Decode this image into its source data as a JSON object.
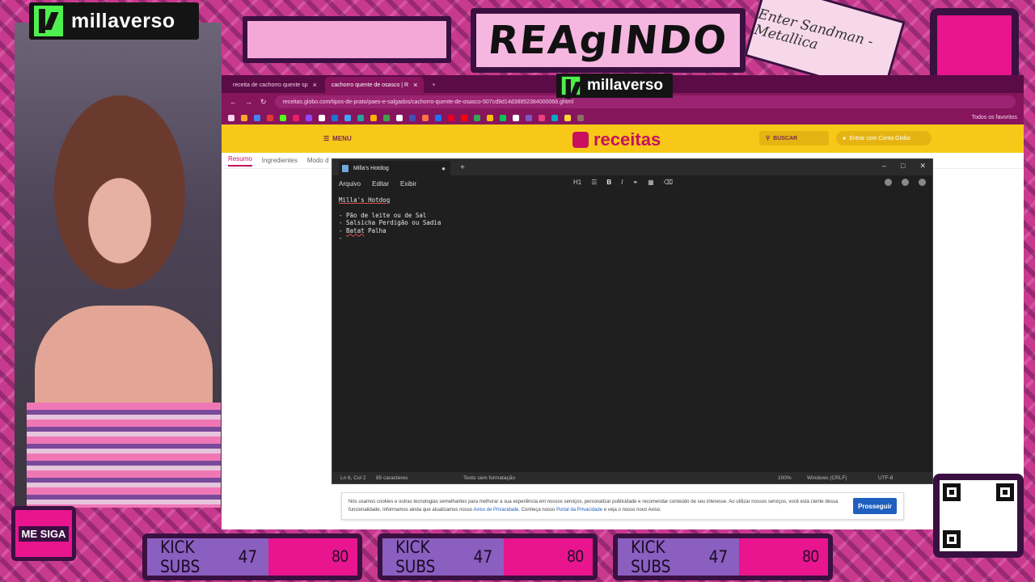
{
  "stream": {
    "channel": "millaverso",
    "banner": "REAgINDO",
    "tape_text": "Enter Sandman - Metallica",
    "follow_label": "ME SIGA",
    "subs_bars": [
      {
        "label": "KICK SUBS",
        "current": "47",
        "goal": "80"
      },
      {
        "label": "KICK SUBS",
        "current": "47",
        "goal": "80"
      },
      {
        "label": "KICK SUBS",
        "current": "47",
        "goal": "80"
      }
    ],
    "accent": "#e8158e"
  },
  "browser": {
    "tabs": [
      {
        "title": "receita de cachorro quente sp"
      },
      {
        "title": "cachorro quente de osasco | R"
      }
    ],
    "url": "receitas.globo.com/tipos-de-prato/paes-e-salgados/cachorro-quente-de-osasco-507cd9d14d38852384000068.ghtml",
    "favorites_label": "Todos os favoritos"
  },
  "site": {
    "menu_label": "MENU",
    "logo": "receitas",
    "search_label": "BUSCAR",
    "login_label": "Entrar com Conta Globo",
    "tabs": [
      "Resumo",
      "Ingredientes",
      "Modo d"
    ],
    "cookie": {
      "text_1": "Nós usamos cookies e outras tecnologias semelhantes para melhorar a sua experiência em nossos serviços, personalizar publicidade e recomendar conteúdo de seu interesse. Ao utilizar nossos serviços, você está ciente dessa",
      "text_2a": "funcionalidade. Informamos ainda que atualizamos nosso ",
      "link_1": "Aviso de Privacidade",
      "text_2b": ". Conheça nosso ",
      "link_2": "Portal da Privacidade",
      "text_2c": " e veja o nosso novo Aviso.",
      "button": "Prosseguir"
    }
  },
  "notepad": {
    "tab_title": "Milla's Hotdog",
    "menu": [
      "Arquivo",
      "Editar",
      "Exibir"
    ],
    "heading_tool": "H1",
    "content_title": "Milla's Hotdog",
    "lines": [
      "- Pão de leite ou de Sal",
      "- Salsicha Perdigão ou Sadia"
    ],
    "line_3_prefix": "- ",
    "line_3_word": "Batat",
    "line_3_suffix": " Palha",
    "line_4": "-",
    "status": {
      "position": "Ln 6, Col 2",
      "chars": "85 caracteres",
      "format": "Texto sem formatação",
      "zoom": "100%",
      "eol": "Windows (CRLF)",
      "encoding": "UTF-8"
    }
  }
}
